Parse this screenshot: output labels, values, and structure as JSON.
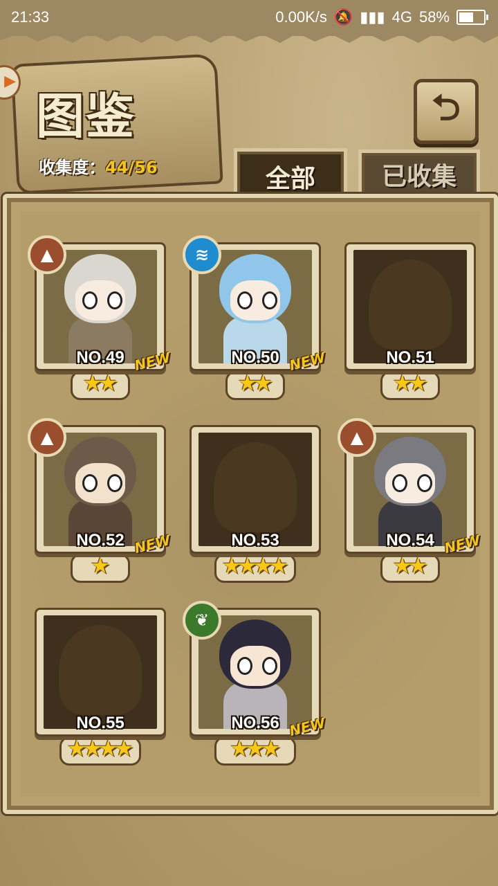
{
  "status_bar": {
    "time": "21:33",
    "net_speed": "0.00K/s",
    "network": "4G",
    "battery": "58%",
    "battery_level": 0.58
  },
  "header": {
    "title": "图鉴",
    "collection_label": "收集度：",
    "collection_value": "44/56",
    "back_icon": "return-arrow-icon"
  },
  "tabs": [
    {
      "label": "全部",
      "active": true
    },
    {
      "label": "已收集",
      "active": false
    }
  ],
  "cards": [
    {
      "number": "NO.49",
      "stars": 2,
      "element": "earth",
      "unlocked": true,
      "new": true,
      "new_label": "NEW"
    },
    {
      "number": "NO.50",
      "stars": 2,
      "element": "water",
      "unlocked": true,
      "new": true,
      "new_label": "NEW"
    },
    {
      "number": "NO.51",
      "stars": 2,
      "element": null,
      "unlocked": false,
      "new": false
    },
    {
      "number": "NO.52",
      "stars": 1,
      "element": "earth",
      "unlocked": true,
      "new": true,
      "new_label": "NEW"
    },
    {
      "number": "NO.53",
      "stars": 4,
      "element": null,
      "unlocked": false,
      "new": false
    },
    {
      "number": "NO.54",
      "stars": 2,
      "element": "earth",
      "unlocked": true,
      "new": true,
      "new_label": "NEW"
    },
    {
      "number": "NO.55",
      "stars": 4,
      "element": null,
      "unlocked": false,
      "new": false
    },
    {
      "number": "NO.56",
      "stars": 3,
      "element": "wood",
      "unlocked": true,
      "new": true,
      "new_label": "NEW"
    }
  ],
  "colors": {
    "star": "#f9c61c",
    "new_badge": "#f5c51f",
    "earth": "#9a4e2e",
    "water": "#1e8ccf",
    "wood": "#3b7a2a"
  }
}
